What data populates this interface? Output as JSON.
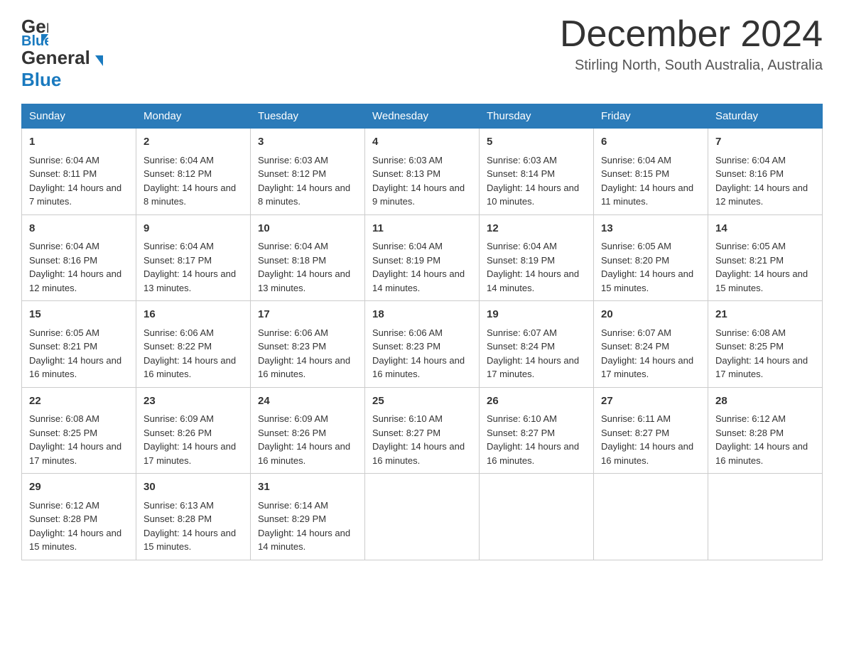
{
  "header": {
    "logo_line1": "General",
    "logo_line2": "Blue",
    "month_year": "December 2024",
    "location": "Stirling North, South Australia, Australia"
  },
  "days_of_week": [
    "Sunday",
    "Monday",
    "Tuesday",
    "Wednesday",
    "Thursday",
    "Friday",
    "Saturday"
  ],
  "weeks": [
    [
      {
        "day": "1",
        "sunrise": "6:04 AM",
        "sunset": "8:11 PM",
        "daylight": "14 hours and 7 minutes."
      },
      {
        "day": "2",
        "sunrise": "6:04 AM",
        "sunset": "8:12 PM",
        "daylight": "14 hours and 8 minutes."
      },
      {
        "day": "3",
        "sunrise": "6:03 AM",
        "sunset": "8:12 PM",
        "daylight": "14 hours and 8 minutes."
      },
      {
        "day": "4",
        "sunrise": "6:03 AM",
        "sunset": "8:13 PM",
        "daylight": "14 hours and 9 minutes."
      },
      {
        "day": "5",
        "sunrise": "6:03 AM",
        "sunset": "8:14 PM",
        "daylight": "14 hours and 10 minutes."
      },
      {
        "day": "6",
        "sunrise": "6:04 AM",
        "sunset": "8:15 PM",
        "daylight": "14 hours and 11 minutes."
      },
      {
        "day": "7",
        "sunrise": "6:04 AM",
        "sunset": "8:16 PM",
        "daylight": "14 hours and 12 minutes."
      }
    ],
    [
      {
        "day": "8",
        "sunrise": "6:04 AM",
        "sunset": "8:16 PM",
        "daylight": "14 hours and 12 minutes."
      },
      {
        "day": "9",
        "sunrise": "6:04 AM",
        "sunset": "8:17 PM",
        "daylight": "14 hours and 13 minutes."
      },
      {
        "day": "10",
        "sunrise": "6:04 AM",
        "sunset": "8:18 PM",
        "daylight": "14 hours and 13 minutes."
      },
      {
        "day": "11",
        "sunrise": "6:04 AM",
        "sunset": "8:19 PM",
        "daylight": "14 hours and 14 minutes."
      },
      {
        "day": "12",
        "sunrise": "6:04 AM",
        "sunset": "8:19 PM",
        "daylight": "14 hours and 14 minutes."
      },
      {
        "day": "13",
        "sunrise": "6:05 AM",
        "sunset": "8:20 PM",
        "daylight": "14 hours and 15 minutes."
      },
      {
        "day": "14",
        "sunrise": "6:05 AM",
        "sunset": "8:21 PM",
        "daylight": "14 hours and 15 minutes."
      }
    ],
    [
      {
        "day": "15",
        "sunrise": "6:05 AM",
        "sunset": "8:21 PM",
        "daylight": "14 hours and 16 minutes."
      },
      {
        "day": "16",
        "sunrise": "6:06 AM",
        "sunset": "8:22 PM",
        "daylight": "14 hours and 16 minutes."
      },
      {
        "day": "17",
        "sunrise": "6:06 AM",
        "sunset": "8:23 PM",
        "daylight": "14 hours and 16 minutes."
      },
      {
        "day": "18",
        "sunrise": "6:06 AM",
        "sunset": "8:23 PM",
        "daylight": "14 hours and 16 minutes."
      },
      {
        "day": "19",
        "sunrise": "6:07 AM",
        "sunset": "8:24 PM",
        "daylight": "14 hours and 17 minutes."
      },
      {
        "day": "20",
        "sunrise": "6:07 AM",
        "sunset": "8:24 PM",
        "daylight": "14 hours and 17 minutes."
      },
      {
        "day": "21",
        "sunrise": "6:08 AM",
        "sunset": "8:25 PM",
        "daylight": "14 hours and 17 minutes."
      }
    ],
    [
      {
        "day": "22",
        "sunrise": "6:08 AM",
        "sunset": "8:25 PM",
        "daylight": "14 hours and 17 minutes."
      },
      {
        "day": "23",
        "sunrise": "6:09 AM",
        "sunset": "8:26 PM",
        "daylight": "14 hours and 17 minutes."
      },
      {
        "day": "24",
        "sunrise": "6:09 AM",
        "sunset": "8:26 PM",
        "daylight": "14 hours and 16 minutes."
      },
      {
        "day": "25",
        "sunrise": "6:10 AM",
        "sunset": "8:27 PM",
        "daylight": "14 hours and 16 minutes."
      },
      {
        "day": "26",
        "sunrise": "6:10 AM",
        "sunset": "8:27 PM",
        "daylight": "14 hours and 16 minutes."
      },
      {
        "day": "27",
        "sunrise": "6:11 AM",
        "sunset": "8:27 PM",
        "daylight": "14 hours and 16 minutes."
      },
      {
        "day": "28",
        "sunrise": "6:12 AM",
        "sunset": "8:28 PM",
        "daylight": "14 hours and 16 minutes."
      }
    ],
    [
      {
        "day": "29",
        "sunrise": "6:12 AM",
        "sunset": "8:28 PM",
        "daylight": "14 hours and 15 minutes."
      },
      {
        "day": "30",
        "sunrise": "6:13 AM",
        "sunset": "8:28 PM",
        "daylight": "14 hours and 15 minutes."
      },
      {
        "day": "31",
        "sunrise": "6:14 AM",
        "sunset": "8:29 PM",
        "daylight": "14 hours and 14 minutes."
      },
      null,
      null,
      null,
      null
    ]
  ],
  "labels": {
    "sunrise_prefix": "Sunrise: ",
    "sunset_prefix": "Sunset: ",
    "daylight_prefix": "Daylight: "
  }
}
